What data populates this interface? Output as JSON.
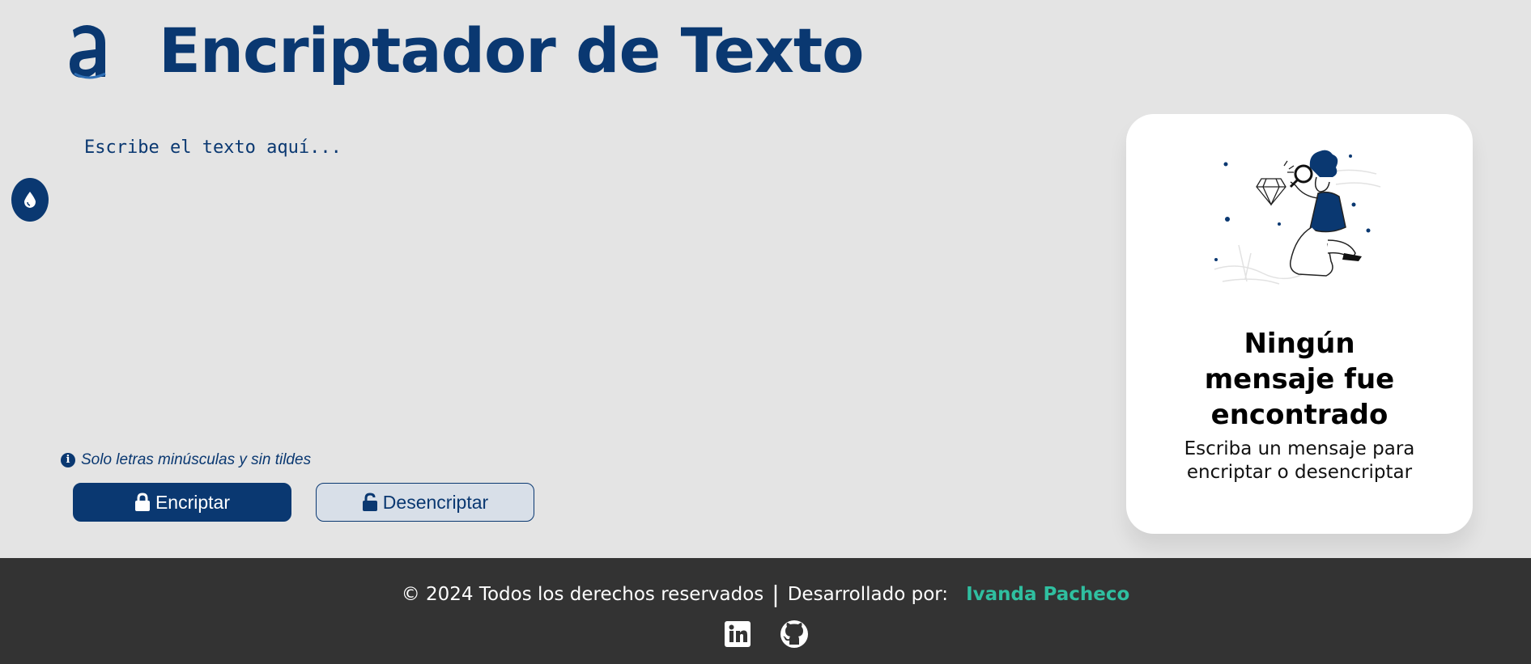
{
  "header": {
    "title": "Encriptador de Texto",
    "logo_icon": "alura-a-logo"
  },
  "theme_toggle": {
    "icon": "droplet-icon"
  },
  "input": {
    "placeholder": "Escribe el texto aquí...",
    "value": ""
  },
  "hint": {
    "icon": "info-circle-icon",
    "text": "Solo letras minúsculas y sin tildes"
  },
  "buttons": {
    "encrypt": {
      "label": "Encriptar",
      "icon": "lock-icon"
    },
    "decrypt": {
      "label": "Desencriptar",
      "icon": "unlock-icon"
    }
  },
  "output_card": {
    "illustration": "person-with-magnifying-glass-illustration",
    "title": "Ningún mensaje fue encontrado",
    "text": "Escriba un mensaje para encriptar o desencriptar"
  },
  "footer": {
    "copyright": "© 2024 Todos los derechos reservados",
    "separator": "|",
    "developed_by": "Desarrollado por:",
    "author": "Ivanda Pacheco",
    "social": [
      {
        "name": "linkedin-icon"
      },
      {
        "name": "github-icon"
      }
    ]
  },
  "colors": {
    "background": "#e4e4e4",
    "primary": "#0a3871",
    "accent": "#2fbfa0",
    "footer_bg": "#333333",
    "card_bg": "#ffffff"
  }
}
